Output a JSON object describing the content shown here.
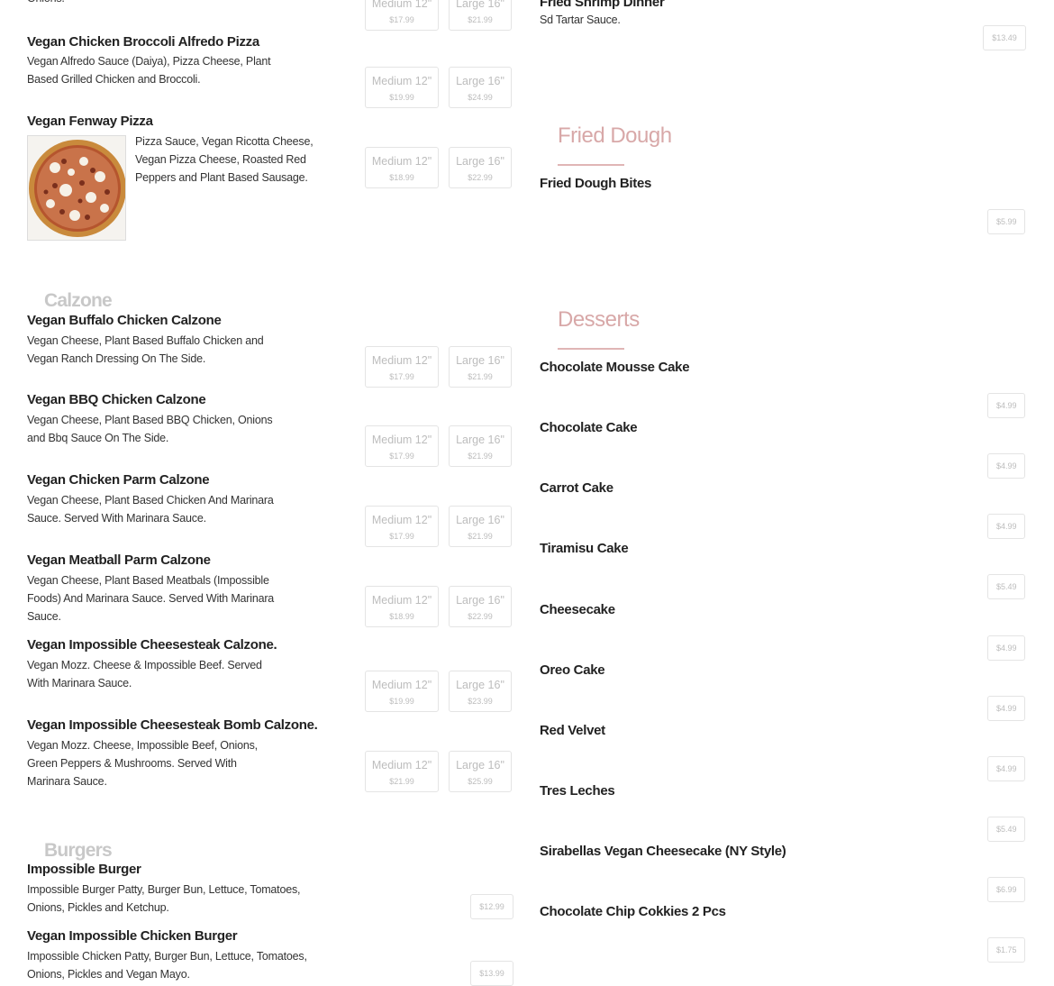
{
  "left": {
    "cut_text": "Onions.",
    "top_sizes": {
      "medium_price": "$17.99",
      "large_price": "$21.99",
      "medium_label": "Medium 12\"",
      "large_label": "Large 16\""
    },
    "pizzas": [
      {
        "title": "Vegan Chicken Broccoli Alfredo Pizza",
        "desc_lines": [
          "Vegan Alfredo Sauce (Daiya), Pizza Cheese, Plant",
          "Based Grilled Chicken and Broccoli."
        ],
        "medium": "$19.99",
        "large": "$24.99"
      },
      {
        "title": "Vegan Fenway Pizza",
        "desc_lines": [
          "Pizza Sauce, Vegan Ricotta Cheese,",
          "Vegan Pizza Cheese, Roasted Red",
          "Peppers and Plant Based Sausage."
        ],
        "medium": "$18.99",
        "large": "$22.99"
      }
    ],
    "size_labels": {
      "medium": "Medium 12\"",
      "large": "Large 16\""
    },
    "calzone_heading": "Calzone",
    "calzones": [
      {
        "title": "Vegan Buffalo Chicken Calzone",
        "desc_lines": [
          "Vegan Cheese, Plant Based Buffalo Chicken and",
          "Vegan Ranch Dressing On The Side."
        ],
        "medium": "$17.99",
        "large": "$21.99"
      },
      {
        "title": "Vegan BBQ Chicken Calzone",
        "desc_lines": [
          "Vegan Cheese, Plant Based BBQ Chicken, Onions",
          "and Bbq Sauce On The Side."
        ],
        "medium": "$17.99",
        "large": "$21.99"
      },
      {
        "title": "Vegan Chicken Parm Calzone",
        "desc_lines": [
          "Vegan Cheese, Plant Based Chicken And Marinara",
          "Sauce. Served With Marinara Sauce."
        ],
        "medium": "$17.99",
        "large": "$21.99"
      },
      {
        "title": "Vegan Meatball Parm Calzone",
        "desc_lines": [
          "Vegan Cheese, Plant Based Meatbals (Impossible",
          "Foods) And Marinara Sauce. Served With Marinara",
          "Sauce."
        ],
        "medium": "$18.99",
        "large": "$22.99"
      },
      {
        "title": "Vegan Impossible Cheesesteak Calzone.",
        "desc_lines": [
          "Vegan Mozz. Cheese & Impossible Beef. Served",
          "With Marinara Sauce."
        ],
        "medium": "$19.99",
        "large": "$23.99"
      },
      {
        "title": "Vegan Impossible Cheesesteak Bomb Calzone.",
        "desc_lines": [
          "Vegan Mozz. Cheese, Impossible Beef, Onions,",
          "Green Peppers & Mushrooms. Served With",
          "Marinara Sauce."
        ],
        "medium": "$21.99",
        "large": "$25.99"
      }
    ],
    "burgers_heading": "Burgers",
    "burgers": [
      {
        "title": "Impossible Burger",
        "desc_lines": [
          "Impossible Burger Patty, Burger Bun, Lettuce, Tomatoes,",
          "Onions, Pickles and Ketchup."
        ],
        "price": "$12.99"
      },
      {
        "title": "Vegan Impossible Chicken Burger",
        "desc_lines": [
          "Impossible Chicken Patty, Burger Bun, Lettuce, Tomatoes,",
          "Onions, Pickles and Vegan Mayo."
        ],
        "price": "$13.99"
      }
    ]
  },
  "right": {
    "shrimp": {
      "title": "Fried Shrimp Dinner",
      "desc": "Sd Tartar Sauce.",
      "price": "$13.49"
    },
    "fried_dough_heading": "Fried Dough",
    "fried_dough": [
      {
        "title": "Fried Dough Bites",
        "price": "$5.99"
      }
    ],
    "desserts_heading": "Desserts",
    "desserts": [
      {
        "title": "Chocolate Mousse Cake",
        "price": "$4.99"
      },
      {
        "title": "Chocolate Cake",
        "price": "$4.99"
      },
      {
        "title": "Carrot Cake",
        "price": "$4.99"
      },
      {
        "title": "Tiramisu Cake",
        "price": "$5.49"
      },
      {
        "title": "Cheesecake",
        "price": "$4.99"
      },
      {
        "title": "Oreo Cake",
        "price": "$4.99"
      },
      {
        "title": "Red Velvet",
        "price": "$4.99"
      },
      {
        "title": "Tres Leches",
        "price": "$5.49"
      },
      {
        "title": "Sirabellas Vegan Cheesecake (NY Style)",
        "price": "$6.99"
      },
      {
        "title": "Chocolate Chip Cokkies 2 Pcs",
        "price": "$1.75"
      }
    ]
  },
  "colors": {
    "heading_left": "#c8c8c8",
    "heading_right": "#d8a8a8",
    "accent_line": "#e0b5b5",
    "button_border": "#e4e4e4"
  }
}
